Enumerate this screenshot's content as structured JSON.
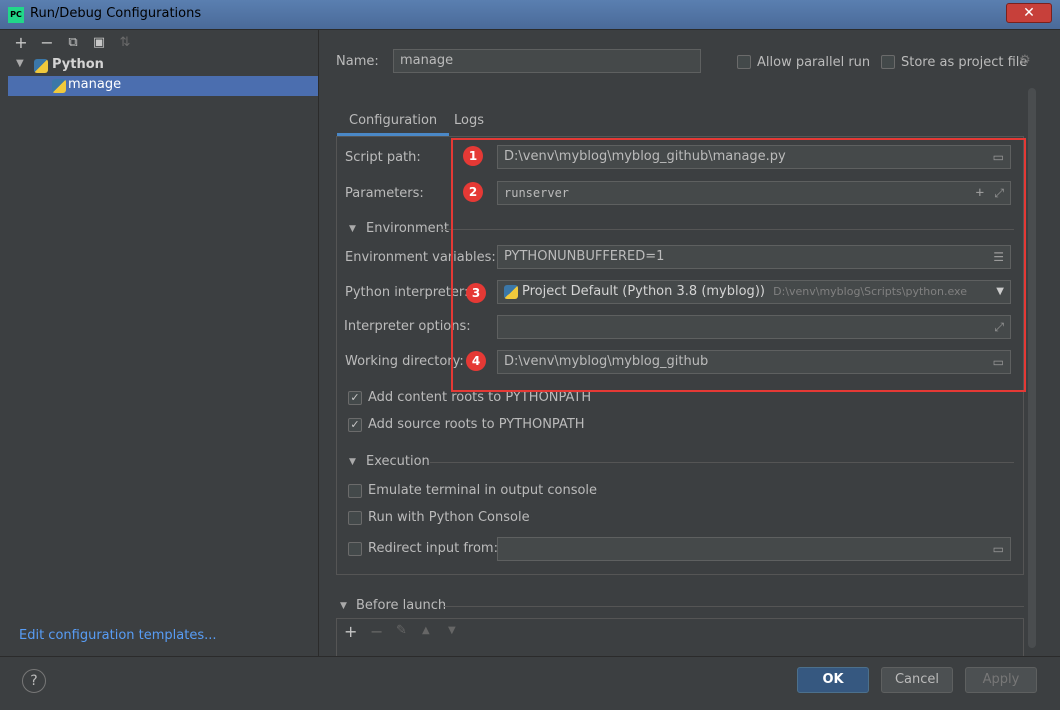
{
  "window": {
    "title": "Run/Debug Configurations",
    "app_icon_text": "PC",
    "close_glyph": "✕"
  },
  "left_toolbar": {
    "add": "+",
    "remove": "−",
    "copy": "⧉",
    "folder": "▣",
    "sort": "⇅"
  },
  "tree": {
    "group_label": "Python",
    "selected_item": "manage"
  },
  "edit_templates_link": "Edit configuration templates...",
  "header": {
    "name_label": "Name:",
    "name_value": "manage",
    "allow_parallel_label": "Allow parallel run",
    "store_as_project_label": "Store as project file"
  },
  "tabs": [
    {
      "label": "Configuration"
    },
    {
      "label": "Logs"
    }
  ],
  "config": {
    "script_path_label": "Script path:",
    "script_path_value": "D:\\venv\\myblog\\myblog_github\\manage.py",
    "parameters_label": "Parameters:",
    "parameters_value": "runserver",
    "environment_section": "Environment",
    "env_vars_label": "Environment variables:",
    "env_vars_value": "PYTHONUNBUFFERED=1",
    "interpreter_label": "Python interpreter:",
    "interpreter_value": "Project Default (Python 3.8 (myblog))",
    "interpreter_path": "D:\\venv\\myblog\\Scripts\\python.exe",
    "interpreter_options_label": "Interpreter options:",
    "interpreter_options_value": "",
    "working_dir_label": "Working directory:",
    "working_dir_value": "D:\\venv\\myblog\\myblog_github",
    "add_content_roots_label": "Add content roots to PYTHONPATH",
    "add_content_roots_checked": true,
    "add_source_roots_label": "Add source roots to PYTHONPATH",
    "add_source_roots_checked": true,
    "execution_section": "Execution",
    "emulate_terminal_label": "Emulate terminal in output console",
    "run_with_console_label": "Run with Python Console",
    "redirect_input_label": "Redirect input from:",
    "redirect_input_value": ""
  },
  "annotations": {
    "badge1": "1",
    "badge2": "2",
    "badge3": "3",
    "badge4": "4"
  },
  "before_launch": {
    "label": "Before launch",
    "add": "+",
    "remove": "−",
    "edit": "✎",
    "up": "▲",
    "down": "▼"
  },
  "buttons": {
    "help": "?",
    "ok": "OK",
    "cancel": "Cancel",
    "apply": "Apply"
  },
  "colors": {
    "accent": "#4a88c7",
    "selection": "#4b6eaf",
    "annotation_red": "#e53935",
    "link": "#589df6"
  }
}
